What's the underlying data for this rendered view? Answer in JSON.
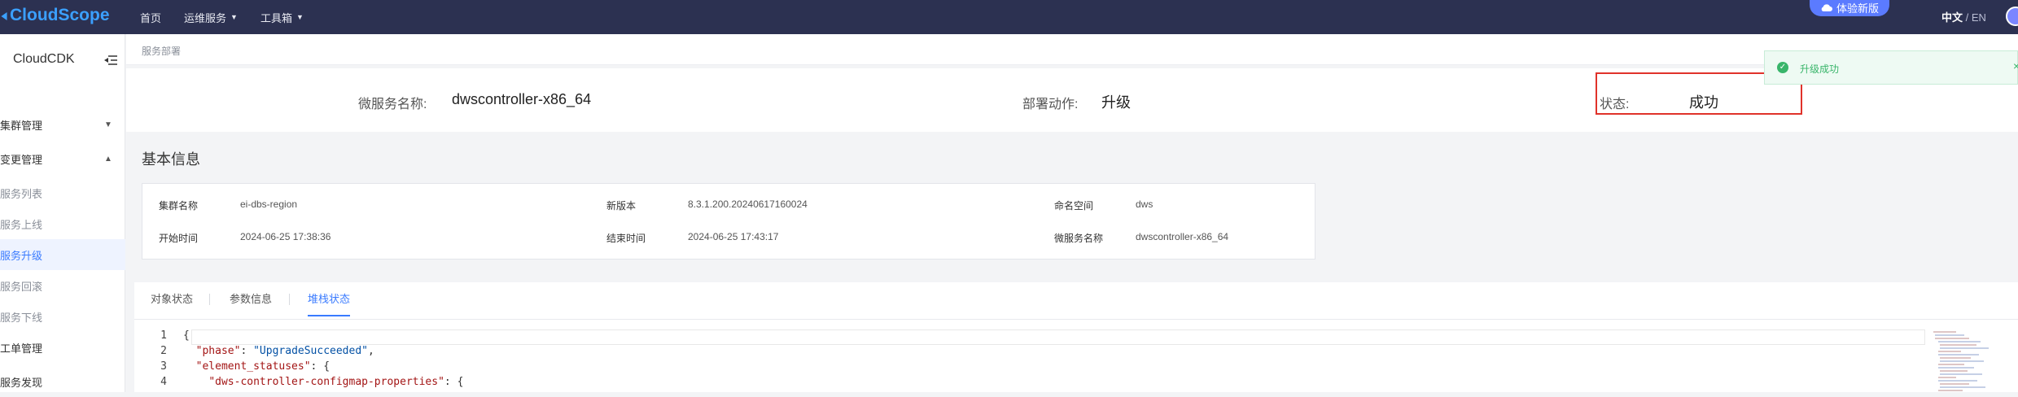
{
  "topbar": {
    "logo": "CloudScope",
    "nav": [
      {
        "label": "首页",
        "dropdown": false
      },
      {
        "label": "运维服务",
        "dropdown": true
      },
      {
        "label": "工具箱",
        "dropdown": true
      }
    ],
    "experience_btn": "体验新版",
    "lang_active": "中文",
    "lang_sep": "/",
    "lang_other": "EN"
  },
  "sidebar": {
    "title": "CloudCDK",
    "groups": [
      {
        "label": "集群管理",
        "expanded": false
      },
      {
        "label": "变更管理",
        "expanded": true
      }
    ],
    "sub_items": [
      {
        "label": "服务列表",
        "active": false
      },
      {
        "label": "服务上线",
        "active": false
      },
      {
        "label": "服务升级",
        "active": true
      },
      {
        "label": "服务回滚",
        "active": false
      },
      {
        "label": "服务下线",
        "active": false
      }
    ],
    "other_items": [
      {
        "label": "工单管理"
      },
      {
        "label": "服务发现"
      }
    ]
  },
  "breadcrumb": "服务部署",
  "summary": {
    "service_name_label": "微服务名称:",
    "service_name": "dwscontroller-x86_64",
    "action_label": "部署动作:",
    "action": "升级",
    "status_label": "状态:",
    "status": "成功"
  },
  "basic_info": {
    "title": "基本信息",
    "fields": [
      {
        "label": "集群名称",
        "value": "ei-dbs-region"
      },
      {
        "label": "新版本",
        "value": "8.3.1.200.20240617160024"
      },
      {
        "label": "命名空间",
        "value": "dws"
      },
      {
        "label": "开始时间",
        "value": "2024-06-25 17:38:36"
      },
      {
        "label": "结束时间",
        "value": "2024-06-25 17:43:17"
      },
      {
        "label": "微服务名称",
        "value": "dwscontroller-x86_64"
      }
    ]
  },
  "tabs": [
    {
      "label": "对象状态",
      "active": false
    },
    {
      "label": "参数信息",
      "active": false
    },
    {
      "label": "堆栈状态",
      "active": true
    }
  ],
  "code_lines": [
    {
      "n": "1",
      "text": "{"
    },
    {
      "n": "2",
      "key": "\"phase\"",
      "sep": ": ",
      "val": "\"UpgradeSucceeded\"",
      "end": ","
    },
    {
      "n": "3",
      "key": "\"element_statuses\"",
      "sep": ": ",
      "val": "",
      "end": "{"
    },
    {
      "n": "4",
      "key": "\"dws-controller-configmap-properties\"",
      "sep": ": ",
      "val": "",
      "end": "{"
    }
  ],
  "toast": {
    "message": "升级成功",
    "close": "×"
  },
  "colors": {
    "topbar": "#2c3151",
    "accent": "#3a7bff",
    "logo": "#3ba0ff",
    "success": "#39b56a",
    "highlight_box": "#e0322a"
  }
}
